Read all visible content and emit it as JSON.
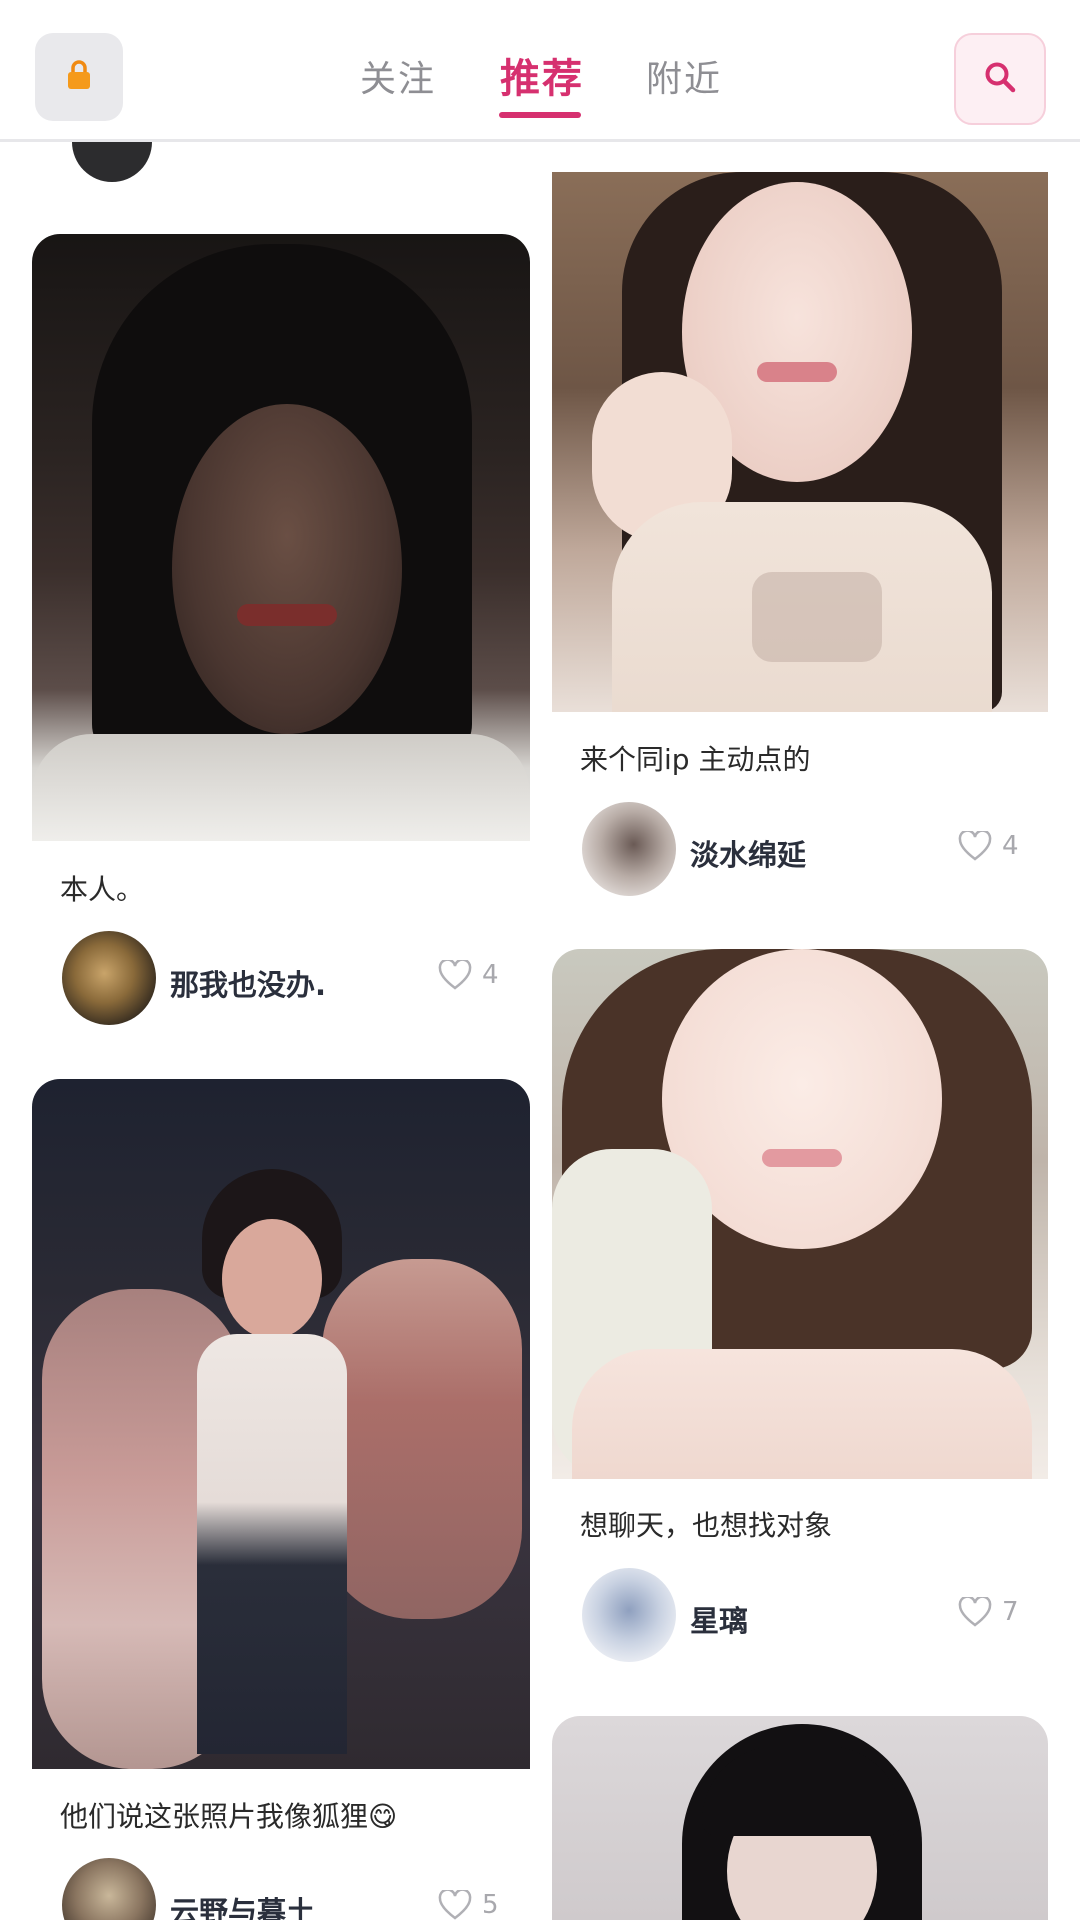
{
  "header": {
    "tabs": [
      {
        "label": "关注",
        "active": false
      },
      {
        "label": "推荐",
        "active": true
      },
      {
        "label": "附近",
        "active": false
      }
    ],
    "lock_icon": "lock-icon",
    "search_icon": "search-icon",
    "accent_color": "#d6306f"
  },
  "feed": {
    "left": [
      {
        "caption": "本人。",
        "author": "那我也没办.",
        "likes": "4"
      },
      {
        "caption": "他们说这张照片我像狐狸😋",
        "author": "云野与暮土",
        "likes": "5"
      }
    ],
    "right": [
      {
        "caption": "来个同ip 主动点的",
        "author": "淡水绵延",
        "likes": "4"
      },
      {
        "caption": "想聊天，也想找对象",
        "author": "星璃",
        "likes": "7"
      }
    ]
  }
}
